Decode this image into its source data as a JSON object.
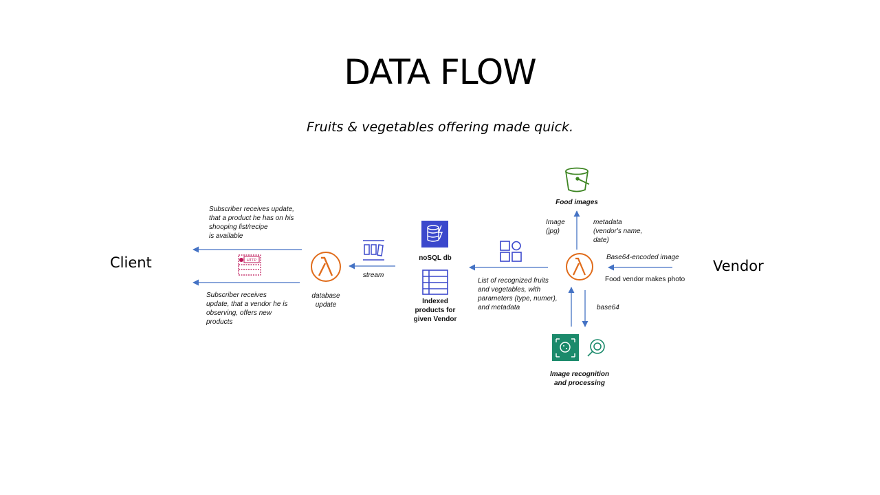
{
  "title": "DATA FLOW",
  "subtitle": "Fruits & vegetables offering made quick.",
  "actors": {
    "client": "Client",
    "vendor": "Vendor"
  },
  "labels": {
    "food_images": "Food images",
    "image_jpg": "Image\n(jpg)",
    "metadata": "metadata\n(vendor's name,\ndate)",
    "base64_encoded_image": "Base64-encoded image",
    "food_vendor_makes_photo": "Food vendor makes photo",
    "base64": "base64",
    "image_recognition": "Image recognition\nand processing",
    "recognized_list": "List of recognized fruits\nand vegetables, with\nparameters (type, numer),\nand metadata",
    "nosql_db": "noSQL db",
    "indexed_products": "Indexed\nproducts for\ngiven Vendor",
    "stream": "stream",
    "database_update": "database\nupdate",
    "subscriber_recipe": "Subscriber receives update,\nthat a product he has on his\nshooping list/recipe\nis available",
    "subscriber_vendor": "Subscriber receives\nupdate, that a vendor he is\nobserving, offers new\nproducts"
  },
  "colors": {
    "arrow": "#4472c4",
    "lambda": "#e06c1b",
    "s3": "#3f8624",
    "dynamodb": "#3b48cc",
    "sns": "#bc1356",
    "rekognition": "#1b8a6b"
  },
  "icons": [
    "s3-bucket-icon",
    "lambda-icon",
    "dynamodb-icon",
    "kinesis-stream-icon",
    "sns-http-icon",
    "rekognition-icon",
    "table-icon",
    "grid-icon"
  ]
}
